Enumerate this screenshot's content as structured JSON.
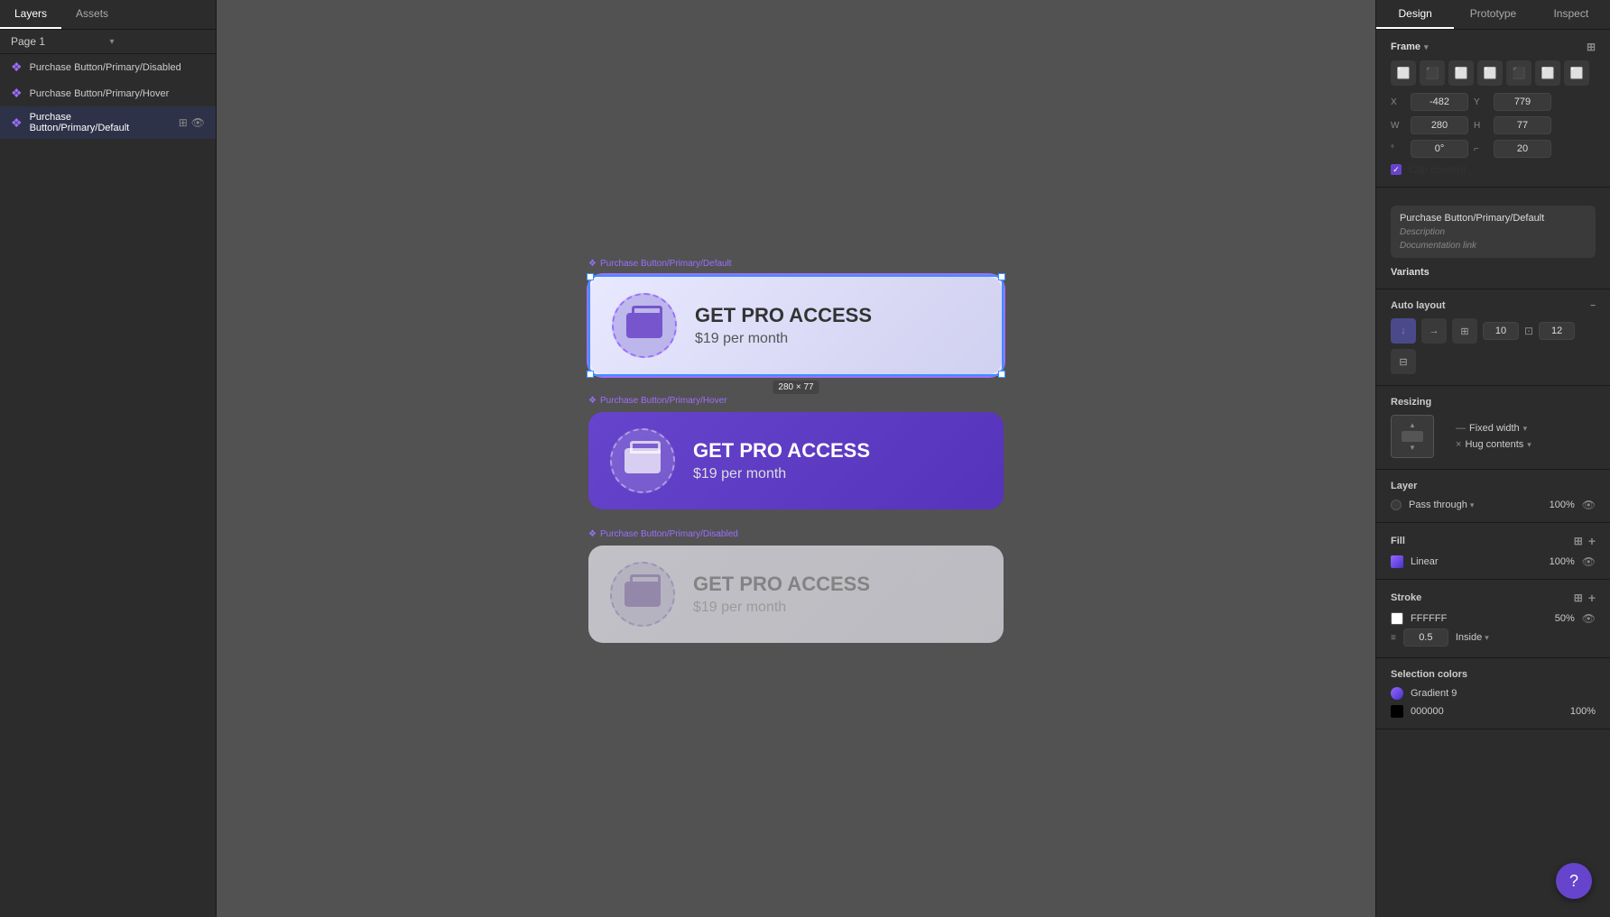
{
  "leftPanel": {
    "tabs": [
      {
        "id": "layers",
        "label": "Layers",
        "active": true
      },
      {
        "id": "assets",
        "label": "Assets",
        "active": false
      }
    ],
    "pageSelector": {
      "label": "Page 1",
      "chevron": "▾"
    },
    "layers": [
      {
        "id": "disabled",
        "label": "Purchase Button/Primary/Disabled",
        "selected": false,
        "hasIcons": false
      },
      {
        "id": "hover",
        "label": "Purchase Button/Primary/Hover",
        "selected": false,
        "hasIcons": false
      },
      {
        "id": "default",
        "label": "Purchase Button/Primary/Default",
        "selected": true,
        "hasIcons": true
      }
    ]
  },
  "canvas": {
    "cards": [
      {
        "id": "default",
        "labelText": "Purchase Button/Primary/Default",
        "title": "GET PRO ACCESS",
        "price": "$19 per month",
        "variant": "default",
        "selected": true,
        "size": "280 × 77"
      },
      {
        "id": "hover",
        "labelText": "Purchase Button/Primary/Hover",
        "title": "GET PRO ACCESS",
        "price": "$19 per month",
        "variant": "hover",
        "selected": false
      },
      {
        "id": "disabled",
        "labelText": "Purchase Button/Primary/Disabled",
        "title": "GET PRO ACCESS",
        "price": "$19 per month",
        "variant": "disabled",
        "selected": false
      }
    ]
  },
  "rightPanel": {
    "tabs": [
      {
        "id": "design",
        "label": "Design",
        "active": true
      },
      {
        "id": "prototype",
        "label": "Prototype",
        "active": false
      },
      {
        "id": "inspect",
        "label": "Inspect",
        "active": false
      }
    ],
    "frame": {
      "sectionTitle": "Frame",
      "x": {
        "label": "X",
        "value": "-482"
      },
      "y": {
        "label": "Y",
        "value": "779"
      },
      "w": {
        "label": "W",
        "value": "280"
      },
      "h": {
        "label": "H",
        "value": "77"
      },
      "r": {
        "label": "°",
        "value": "0°"
      },
      "clip": {
        "label": "Clip content",
        "checked": true
      }
    },
    "componentInfo": {
      "name": "Purchase Button/Primary/Default",
      "descPlaceholder": "Description",
      "docPlaceholder": "Documentation link",
      "variants": "Variants"
    },
    "autoLayout": {
      "sectionTitle": "Auto layout",
      "spacing": "10",
      "padding": "12"
    },
    "resizing": {
      "sectionTitle": "Resizing",
      "widthOption": "Fixed width",
      "heightOption": "Hug contents"
    },
    "layer": {
      "sectionTitle": "Layer",
      "mode": "Pass through",
      "opacity": "100%"
    },
    "fill": {
      "sectionTitle": "Fill",
      "type": "Linear",
      "opacity": "100%"
    },
    "stroke": {
      "sectionTitle": "Stroke",
      "color": "FFFFFF",
      "opacity": "50%",
      "width": "0.5",
      "position": "Inside"
    },
    "selectionColors": {
      "sectionTitle": "Selection colors",
      "items": [
        {
          "name": "Gradient 9",
          "color": "#6644cc",
          "type": "circle-gradient"
        },
        {
          "name": "000000",
          "color": "#000000",
          "opacity": "100%",
          "type": "square"
        }
      ]
    }
  },
  "fab": {
    "icon": "?"
  }
}
